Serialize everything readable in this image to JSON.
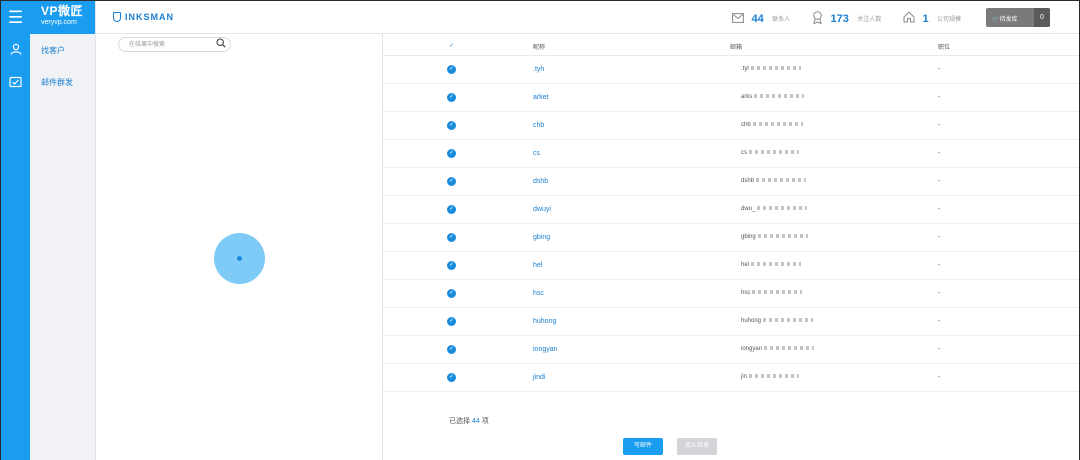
{
  "brand": {
    "logo": "VP微匠",
    "url": "veryvp.com"
  },
  "nav": {
    "items": [
      {
        "label": "找客户",
        "icon": "person-icon"
      },
      {
        "label": "邮件群发",
        "icon": "mail-check-icon"
      }
    ]
  },
  "header": {
    "logo_text": "INKSMAN",
    "stats": [
      {
        "icon": "mail-icon",
        "value": "44",
        "label": "联系人"
      },
      {
        "icon": "award-icon",
        "value": "173",
        "label": "关注人数"
      },
      {
        "icon": "home-icon",
        "value": "1",
        "label": "公司规模"
      }
    ],
    "cart": {
      "label": "待发库",
      "count": "0"
    }
  },
  "search": {
    "placeholder": "在结果中搜索"
  },
  "table": {
    "columns": [
      "✓",
      "昵称",
      "邮箱",
      "职位"
    ],
    "rows": [
      {
        "name": ".tyh",
        "email": ".tyl",
        "position": "-"
      },
      {
        "name": "arket",
        "email": "arks",
        "position": "-"
      },
      {
        "name": "chb",
        "email": "chb",
        "position": "-"
      },
      {
        "name": "cs",
        "email": "cs",
        "position": "-"
      },
      {
        "name": "dshb",
        "email": "dshb",
        "position": "-"
      },
      {
        "name": "dwuyi",
        "email": "dwu_",
        "position": "-"
      },
      {
        "name": "gbing",
        "email": "gbing",
        "position": "-"
      },
      {
        "name": "hel",
        "email": "hel",
        "position": "-"
      },
      {
        "name": "hsc",
        "email": "hsc",
        "position": "-"
      },
      {
        "name": "huhong",
        "email": "huhong",
        "position": "-"
      },
      {
        "name": "iongyan",
        "email": "iongyan",
        "position": "-"
      },
      {
        "name": "jindi",
        "email": "jin",
        "position": "-"
      }
    ]
  },
  "footer": {
    "selected_prefix": "已选择",
    "selected_count": "44",
    "selected_suffix": "项",
    "primary_button": "写邮件",
    "secondary_button": "加入待发"
  },
  "colors": {
    "accent": "#1a9cf0",
    "link": "#1a7fd0"
  }
}
